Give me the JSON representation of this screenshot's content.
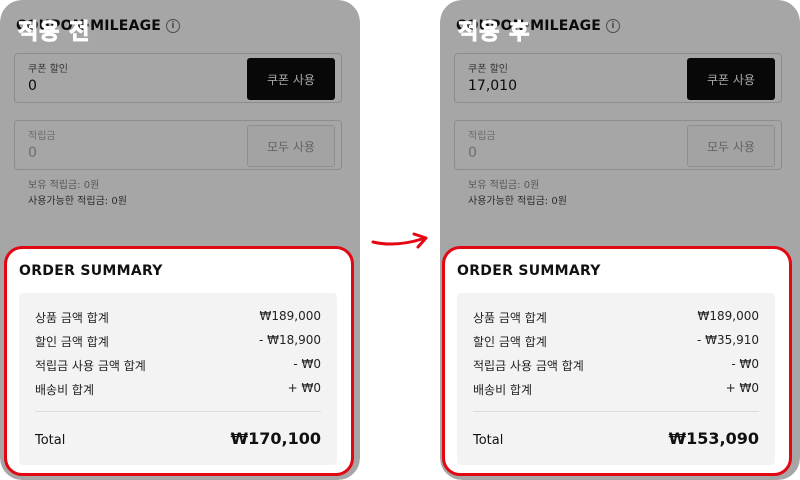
{
  "panels": [
    {
      "badge": "적용 전",
      "header_title": "COUPON·MILEAGE",
      "info_glyph": "i",
      "coupon_label": "쿠폰 할인",
      "coupon_value": "0",
      "coupon_button": "쿠폰 사용",
      "mileage_label": "적립금",
      "mileage_value": "0",
      "mileage_button": "모두 사용",
      "held_mileage": "보유 적립금: 0원",
      "usable_mileage": "사용가능한 적립금: 0원",
      "summary_title": "ORDER SUMMARY",
      "rows": [
        {
          "label": "상품 금액 합계",
          "value": "₩189,000"
        },
        {
          "label": "할인 금액 합계",
          "value": "- ₩18,900"
        },
        {
          "label": "적립금 사용 금액 합계",
          "value": "- ₩0"
        },
        {
          "label": "배송비 합계",
          "value": "+ ₩0"
        }
      ],
      "total_label": "Total",
      "total_value": "₩170,100"
    },
    {
      "badge": "적용 후",
      "header_title": "COUPON·MILEAGE",
      "info_glyph": "i",
      "coupon_label": "쿠폰 할인",
      "coupon_value": "17,010",
      "coupon_button": "쿠폰 사용",
      "mileage_label": "적립금",
      "mileage_value": "0",
      "mileage_button": "모두 사용",
      "held_mileage": "보유 적립금: 0원",
      "usable_mileage": "사용가능한 적립금: 0원",
      "summary_title": "ORDER SUMMARY",
      "rows": [
        {
          "label": "상품 금액 합계",
          "value": "₩189,000"
        },
        {
          "label": "할인 금액 합계",
          "value": "- ₩35,910"
        },
        {
          "label": "적립금 사용 금액 합계",
          "value": "- ₩0"
        },
        {
          "label": "배송비 합계",
          "value": "+ ₩0"
        }
      ],
      "total_label": "Total",
      "total_value": "₩153,090"
    }
  ],
  "colors": {
    "highlight": "#e30613",
    "dark_button": "#0d0d0d",
    "summary_background": "#f3f3f3"
  },
  "icons": [
    "info-icon",
    "arrow-right-icon"
  ]
}
